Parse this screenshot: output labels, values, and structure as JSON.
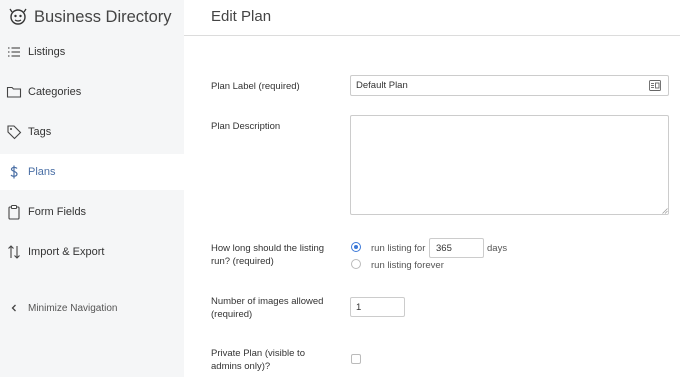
{
  "app": {
    "title": "Business Directory",
    "logo_icon": "directory-logo-icon"
  },
  "sidebar": {
    "items": [
      {
        "label": "Listings",
        "icon": "list-icon",
        "active": false
      },
      {
        "label": "Categories",
        "icon": "folder-icon",
        "active": false
      },
      {
        "label": "Tags",
        "icon": "tag-icon",
        "active": false
      },
      {
        "label": "Plans",
        "icon": "dollar-icon",
        "active": true
      },
      {
        "label": "Form Fields",
        "icon": "clipboard-icon",
        "active": false
      },
      {
        "label": "Import & Export",
        "icon": "import-export-icon",
        "active": false
      }
    ],
    "minimize_label": "Minimize Navigation",
    "minimize_icon": "chevron-left-icon"
  },
  "page": {
    "title": "Edit Plan"
  },
  "form": {
    "plan_label": {
      "label": "Plan Label (required)",
      "value": "Default Plan"
    },
    "plan_description": {
      "label": "Plan Description",
      "value": ""
    },
    "listing_run": {
      "label_line1": "How long should the listing",
      "label_line2": "run? (required)",
      "option_days_prefix": "run listing for",
      "days_value": "365",
      "option_days_suffix": "days",
      "option_forever": "run listing forever",
      "selected": "days"
    },
    "images": {
      "label_line1": "Number of images allowed",
      "label_line2": "(required)",
      "value": "1"
    },
    "private_plan": {
      "label_line1": "Private Plan (visible to",
      "label_line2": "admins only)?",
      "checked": false
    }
  },
  "colors": {
    "accent": "#3b78d8",
    "active_nav_text": "#4a6fa5",
    "sidebar_bg": "#f5f6f7"
  }
}
